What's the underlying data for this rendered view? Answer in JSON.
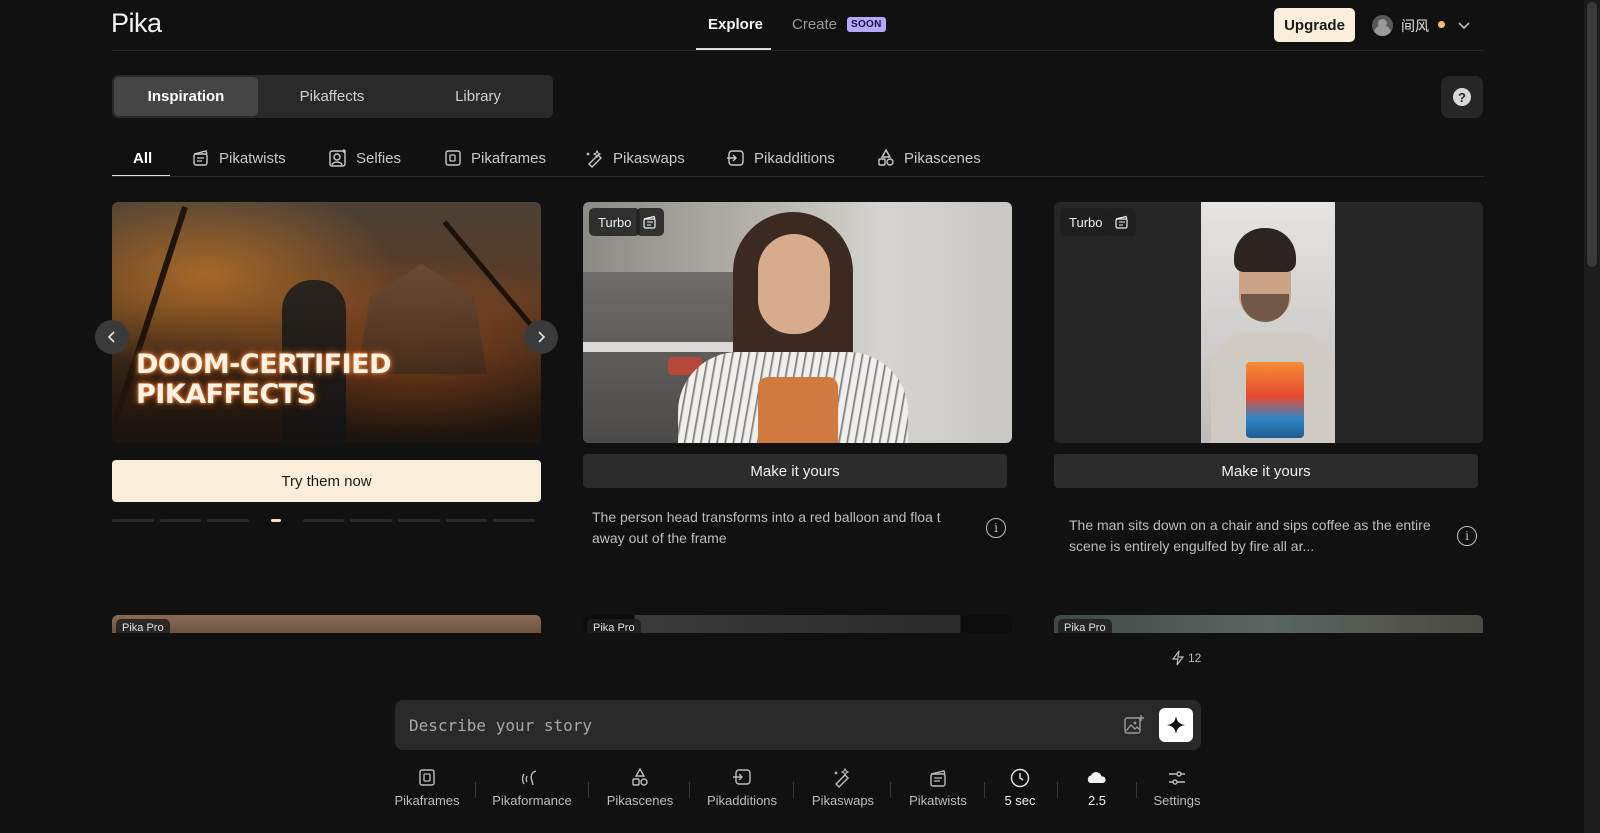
{
  "header": {
    "logo": "Pika",
    "nav": {
      "explore": "Explore",
      "create": "Create",
      "soon_badge": "SOON"
    },
    "upgrade_label": "Upgrade",
    "username": "间风"
  },
  "section_tabs": [
    "Inspiration",
    "Pikaffects",
    "Library"
  ],
  "filter_tabs": [
    "All",
    "Pikatwists",
    "Selfies",
    "Pikaframes",
    "Pikaswaps",
    "Pikadditions",
    "Pikascenes"
  ],
  "hero": {
    "title_line1": "DOOM-CERTIFIED",
    "title_line2": "PIKAFFECTS",
    "button_label": "Try them now",
    "dot_count": 9,
    "active_dot": 3
  },
  "cards": [
    {
      "badge": "Turbo",
      "icon": "pikatwists-icon",
      "button_label": "Make it yours",
      "prompt": "The person head transforms into a red balloon and floa t away out of the frame"
    },
    {
      "badge": "Turbo",
      "icon": "pikatwists-icon",
      "button_label": "Make it yours",
      "prompt": "The man sits down on a chair and sips coffee as the entire scene is entirely engulfed by fire all ar..."
    }
  ],
  "next_row_badges": [
    "Pika Pro",
    "Pika Pro",
    "Pika Pro"
  ],
  "credits": "12",
  "prompt_bar": {
    "placeholder": "Describe your story"
  },
  "toolbar": [
    {
      "label": "Pikaframes",
      "icon": "pikaframes-icon"
    },
    {
      "label": "Pikaformance",
      "icon": "pikaformance-icon"
    },
    {
      "label": "Pikascenes",
      "icon": "pikascenes-icon"
    },
    {
      "label": "Pikadditions",
      "icon": "pikadditions-icon"
    },
    {
      "label": "Pikaswaps",
      "icon": "pikaswaps-icon"
    },
    {
      "label": "Pikatwists",
      "icon": "pikatwists-icon"
    },
    {
      "label": "5 sec",
      "icon": "clock-icon"
    },
    {
      "label": "2.5",
      "icon": "cloud-icon"
    },
    {
      "label": "Settings",
      "icon": "settings-icon"
    }
  ],
  "colors": {
    "accent_cream": "#fbeeda",
    "soon_badge": "#b7a7ff",
    "background": "#111111",
    "status_dot": "#f4c06a"
  }
}
